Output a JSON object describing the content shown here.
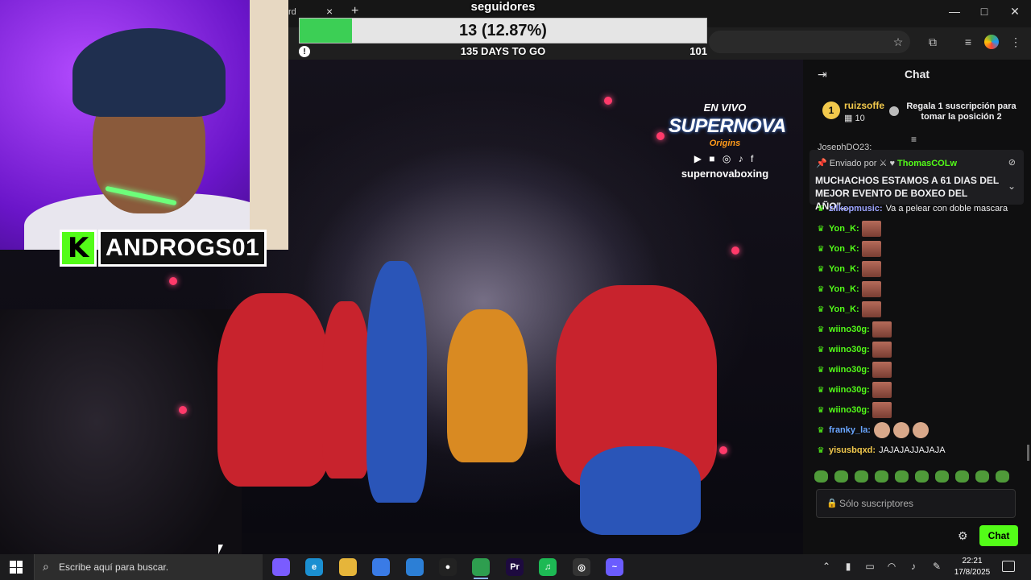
{
  "browser": {
    "tab_fragment": "rd",
    "tab_close": "×",
    "tab_new": "+",
    "window_controls": {
      "minimize": "—",
      "maximize": "□",
      "close": "✕"
    }
  },
  "goal": {
    "title": "seguidores",
    "value_text": "13 (12.87%)",
    "progress_fraction": 0.1287,
    "start_label": "!",
    "days_text": "135 DAYS TO GO",
    "target": "101",
    "fill_color": "#3ccf55"
  },
  "streamer": {
    "logo_letter": "K",
    "name": "ANDROGS01"
  },
  "watermark": {
    "live": "EN VIVO",
    "brand": "SUPERNOVA",
    "sub": "Origins",
    "socials": "▶ ■ ◎ ♪ f",
    "handle": "supernovaboxing"
  },
  "chat": {
    "title": "Chat",
    "leader": {
      "rank": "1",
      "user": "ruizsoffe",
      "count": "10",
      "promo": "Regala 1 suscripción para tomar la posición 2"
    },
    "top_cut": "JosephDO23:",
    "pinned": {
      "by_label": "Enviado por",
      "user": "ThomasCOLw",
      "text": "MUCHACHOS ESTAMOS A 61 DIAS DEL MEJOR EVENTO DE BOXEO DEL AÑO\"..."
    },
    "messages": [
      {
        "user": "zilkopmusic:",
        "text": "Va a pelear con doble mascara",
        "color": "#9ba3ff",
        "emotes": 0
      },
      {
        "user": "Yon_K:",
        "text": "",
        "color": "#53fc18",
        "emotes": 1
      },
      {
        "user": "Yon_K:",
        "text": "",
        "color": "#53fc18",
        "emotes": 1
      },
      {
        "user": "Yon_K:",
        "text": "",
        "color": "#53fc18",
        "emotes": 1
      },
      {
        "user": "Yon_K:",
        "text": "",
        "color": "#53fc18",
        "emotes": 1
      },
      {
        "user": "Yon_K:",
        "text": "",
        "color": "#53fc18",
        "emotes": 1
      },
      {
        "user": "wiino30g:",
        "text": "",
        "color": "#53fc18",
        "emotes": 1
      },
      {
        "user": "wiino30g:",
        "text": "",
        "color": "#53fc18",
        "emotes": 1
      },
      {
        "user": "wiino30g:",
        "text": "",
        "color": "#53fc18",
        "emotes": 1
      },
      {
        "user": "wiino30g:",
        "text": "",
        "color": "#53fc18",
        "emotes": 1
      },
      {
        "user": "wiino30g:",
        "text": "",
        "color": "#53fc18",
        "emotes": 1
      },
      {
        "user": "franky_la:",
        "text": "",
        "color": "#6aa6ff",
        "emotes": 3
      },
      {
        "user": "yisusbqxd:",
        "text": "JAJAJAJJAJAJA",
        "color": "#f2c94c",
        "emotes": 0
      }
    ],
    "input_placeholder": "Sólo suscriptores",
    "send_label": "Chat"
  },
  "taskbar": {
    "search_placeholder": "Escribe aquí para buscar.",
    "time": "22:21",
    "date": "17/8/2025",
    "apps": [
      {
        "name": "copilot-app",
        "label": "",
        "color": "#7a5cff"
      },
      {
        "name": "edge-app",
        "label": "e",
        "color": "#1b8fd1"
      },
      {
        "name": "file-explorer-app",
        "label": "",
        "color": "#e6b53a"
      },
      {
        "name": "store-app",
        "label": "",
        "color": "#3a7be6"
      },
      {
        "name": "mail-app",
        "label": "",
        "color": "#2c7fd6"
      },
      {
        "name": "record-app",
        "label": "●",
        "color": "#222222"
      },
      {
        "name": "chrome-app",
        "label": "",
        "color": "#2e9e4f"
      },
      {
        "name": "premiere-app",
        "label": "Pr",
        "color": "#1d0a3f"
      },
      {
        "name": "spotify-app",
        "label": "♫",
        "color": "#1db954"
      },
      {
        "name": "obs-app",
        "label": "◎",
        "color": "#333333"
      },
      {
        "name": "messenger-app",
        "label": "~",
        "color": "#6b5cff"
      }
    ]
  }
}
